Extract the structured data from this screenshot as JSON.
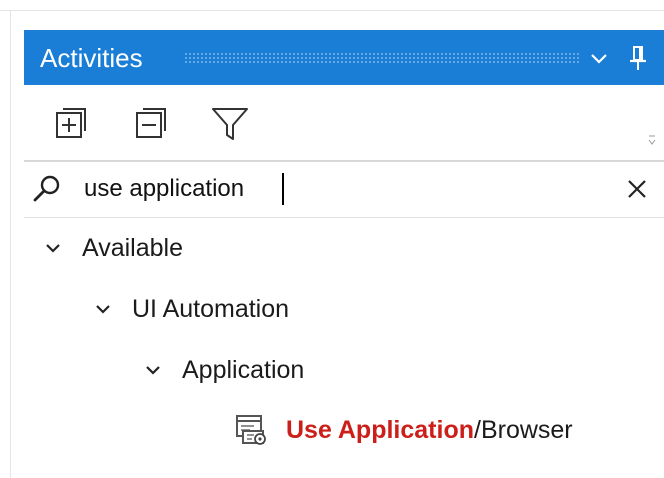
{
  "panel": {
    "title": "Activities",
    "icons": {
      "collapse_menu": "chevron-down-icon",
      "pin": "pin-icon"
    }
  },
  "toolbar": {
    "expand_all_icon": "expand-all-icon",
    "collapse_all_icon": "collapse-all-icon",
    "filter_icon": "filter-icon"
  },
  "search": {
    "value": "use application",
    "placeholder": "",
    "search_icon": "search-icon",
    "clear_icon": "close-icon"
  },
  "tree": {
    "root_label": "Available",
    "group_label": "UI Automation",
    "subgroup_label": "Application",
    "activity": {
      "match": "Use Application",
      "rest": "/Browser",
      "icon": "use-application-icon"
    }
  },
  "colors": {
    "accent": "#1a7ed6",
    "match_highlight": "#cc1f1a"
  }
}
